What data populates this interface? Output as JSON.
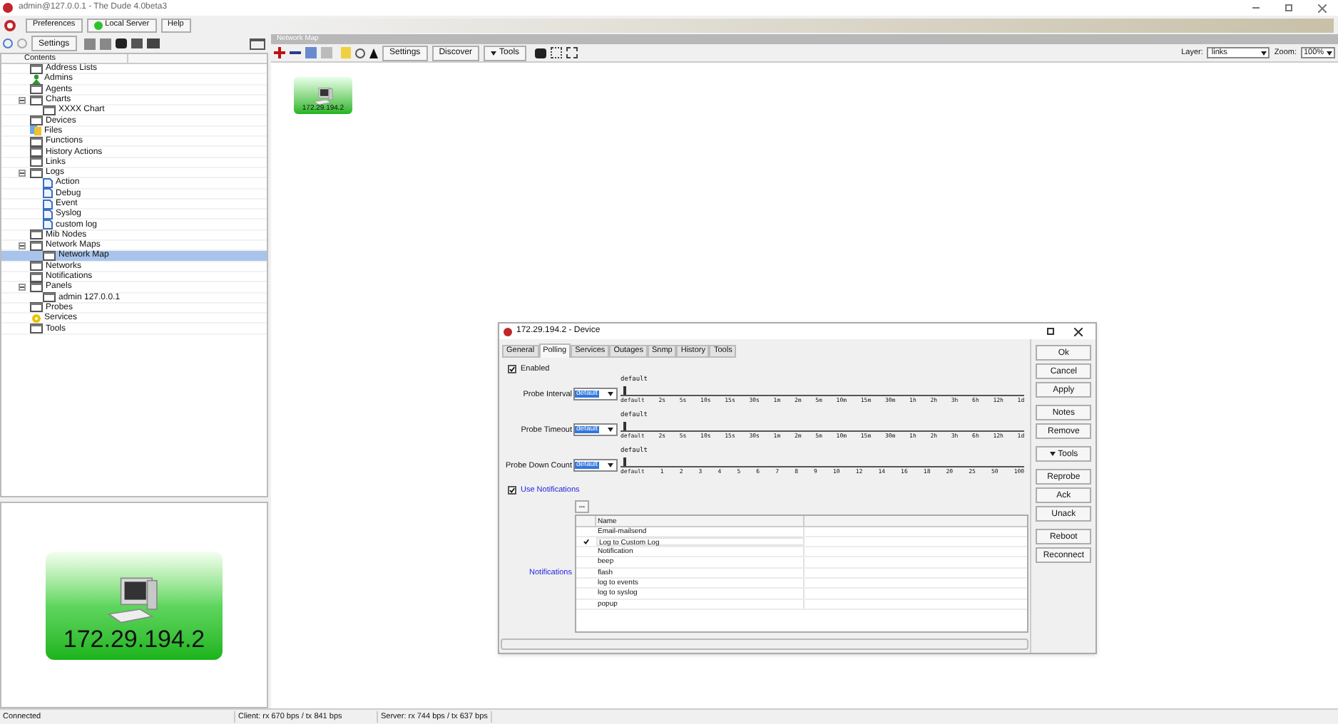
{
  "window": {
    "title": "admin@127.0.0.1 - The Dude 4.0beta3"
  },
  "top_buttons": [
    {
      "label": "Preferences",
      "kind": "plain"
    },
    {
      "label": "Local Server",
      "kind": "status"
    },
    {
      "label": "Help",
      "kind": "plain"
    }
  ],
  "left_toolbar": {
    "settings": "Settings"
  },
  "tree": {
    "header": "Contents",
    "items": [
      {
        "label": "Address Lists",
        "kind": "window",
        "selected": false
      },
      {
        "label": "Admins",
        "kind": "admin",
        "selected": false
      },
      {
        "label": "Agents",
        "kind": "window",
        "selected": false
      },
      {
        "label": "Charts",
        "kind": "window",
        "expanded": true,
        "selected": false,
        "children": [
          {
            "label": "XXXX Chart",
            "kind": "window",
            "selected": false
          }
        ]
      },
      {
        "label": "Devices",
        "kind": "window",
        "selected": false
      },
      {
        "label": "Files",
        "kind": "files",
        "selected": false
      },
      {
        "label": "Functions",
        "kind": "window",
        "selected": false
      },
      {
        "label": "History Actions",
        "kind": "window",
        "selected": false
      },
      {
        "label": "Links",
        "kind": "window",
        "selected": false
      },
      {
        "label": "Logs",
        "kind": "window",
        "expanded": true,
        "selected": false,
        "children": [
          {
            "label": "Action",
            "kind": "log",
            "selected": false
          },
          {
            "label": "Debug",
            "kind": "log",
            "selected": false
          },
          {
            "label": "Event",
            "kind": "log",
            "selected": false
          },
          {
            "label": "Syslog",
            "kind": "log",
            "selected": false
          },
          {
            "label": "custom log",
            "kind": "log",
            "selected": false
          }
        ]
      },
      {
        "label": "Mib Nodes",
        "kind": "window",
        "selected": false
      },
      {
        "label": "Network Maps",
        "kind": "window",
        "expanded": true,
        "selected": false,
        "children": [
          {
            "label": "Network Map",
            "kind": "window",
            "selected": true
          }
        ]
      },
      {
        "label": "Networks",
        "kind": "window",
        "selected": false
      },
      {
        "label": "Notifications",
        "kind": "window",
        "selected": false
      },
      {
        "label": "Panels",
        "kind": "window",
        "expanded": true,
        "selected": false,
        "children": [
          {
            "label": "admin 127.0.0.1",
            "kind": "window",
            "selected": false
          }
        ]
      },
      {
        "label": "Probes",
        "kind": "window",
        "selected": false
      },
      {
        "label": "Services",
        "kind": "services",
        "selected": false
      },
      {
        "label": "Tools",
        "kind": "window",
        "selected": false
      }
    ]
  },
  "preview": {
    "label": "172.29.194.2"
  },
  "map": {
    "title": "Network Map",
    "buttons": [
      {
        "label": "Settings",
        "caret": false
      },
      {
        "label": "Discover",
        "caret": false
      },
      {
        "label": "Tools",
        "caret": true
      }
    ],
    "layer_label": "Layer:",
    "layer_value": "links",
    "zoom_label": "Zoom:",
    "zoom_value": "100%",
    "node_label": "172.29.194.2"
  },
  "dialog": {
    "title": "172.29.194.2 - Device",
    "tabs": [
      {
        "label": "General",
        "selected": false
      },
      {
        "label": "Polling",
        "selected": true
      },
      {
        "label": "Services",
        "selected": false
      },
      {
        "label": "Outages",
        "selected": false
      },
      {
        "label": "Snmp",
        "selected": false
      },
      {
        "label": "History",
        "selected": false
      },
      {
        "label": "Tools",
        "selected": false
      }
    ],
    "enabled": {
      "label": "Enabled",
      "checked": true
    },
    "sliders": [
      {
        "label": "Probe Interval",
        "value": "default",
        "thumb_label": "default",
        "level": 0,
        "ticks": [
          "default",
          "2s",
          "5s",
          "10s",
          "15s",
          "30s",
          "1m",
          "2m",
          "5m",
          "10m",
          "15m",
          "30m",
          "1h",
          "2h",
          "3h",
          "6h",
          "12h",
          "1d"
        ]
      },
      {
        "label": "Probe Timeout",
        "value": "default",
        "thumb_label": "default",
        "level": 0,
        "ticks": [
          "default",
          "2s",
          "5s",
          "10s",
          "15s",
          "30s",
          "1m",
          "2m",
          "5m",
          "10m",
          "15m",
          "30m",
          "1h",
          "2h",
          "3h",
          "6h",
          "12h",
          "1d"
        ]
      },
      {
        "label": "Probe Down Count",
        "value": "default",
        "thumb_label": "default",
        "level": 0,
        "ticks": [
          "default",
          "1",
          "2",
          "3",
          "4",
          "5",
          "6",
          "7",
          "8",
          "9",
          "10",
          "12",
          "14",
          "16",
          "18",
          "20",
          "25",
          "50",
          "100"
        ]
      }
    ],
    "use_notifications": {
      "label": "Use Notifications",
      "checked": true
    },
    "notifications": {
      "label": "Notifications",
      "more": "...",
      "header": "Name",
      "rows": [
        {
          "name": "Email-mailsend",
          "checked": false
        },
        {
          "name": "Log to Custom Log",
          "checked": true
        },
        {
          "name": "Notification",
          "checked": false
        },
        {
          "name": "beep",
          "checked": false
        },
        {
          "name": "flash",
          "checked": false
        },
        {
          "name": "log to events",
          "checked": false
        },
        {
          "name": "log to syslog",
          "checked": false
        },
        {
          "name": "popup",
          "checked": false
        }
      ]
    },
    "button_groups": [
      [
        {
          "label": "Ok",
          "caret": false
        },
        {
          "label": "Cancel",
          "caret": false
        },
        {
          "label": "Apply",
          "caret": false
        }
      ],
      [
        {
          "label": "Notes",
          "caret": false
        },
        {
          "label": "Remove",
          "caret": false
        }
      ],
      [
        {
          "label": "Tools",
          "caret": true
        }
      ],
      [
        {
          "label": "Reprobe",
          "caret": false
        },
        {
          "label": "Ack",
          "caret": false
        },
        {
          "label": "Unack",
          "caret": false
        }
      ],
      [
        {
          "label": "Reboot",
          "caret": false
        },
        {
          "label": "Reconnect",
          "caret": false
        }
      ]
    ]
  },
  "status_bar": [
    "Connected",
    "Client: rx 670 bps / tx 841 bps",
    "Server: rx 744 bps / tx 637 bps"
  ]
}
